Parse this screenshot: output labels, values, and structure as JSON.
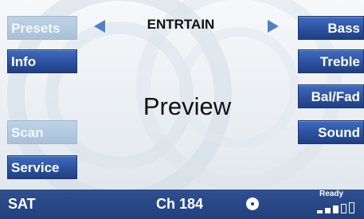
{
  "left_buttons": [
    {
      "label": "Presets",
      "state": "inactive"
    },
    {
      "label": "Info",
      "state": "active"
    },
    {
      "label": "Scan",
      "state": "inactive"
    },
    {
      "label": "Service",
      "state": "active"
    }
  ],
  "right_buttons": [
    {
      "label": "Bass",
      "state": "active"
    },
    {
      "label": "Treble",
      "state": "active"
    },
    {
      "label": "Bal/Fad",
      "state": "active"
    },
    {
      "label": "Sound",
      "state": "active"
    }
  ],
  "band": {
    "label": "ENTRTAIN",
    "prev_icon": "left-triangle-arrow",
    "next_icon": "right-triangle-arrow"
  },
  "main": {
    "title": "Preview"
  },
  "status_bar": {
    "source": "SAT",
    "channel": "Ch 184",
    "ready": "Ready",
    "disc_icon": "disc-icon",
    "signal_icon": "signal-strength-icon",
    "signal_level": 0.6
  },
  "colors": {
    "active_button": "#2a4f9b",
    "inactive_button": "#b4cbe0",
    "status_bar": "#22407c",
    "arrow": "#4e7fc9"
  }
}
